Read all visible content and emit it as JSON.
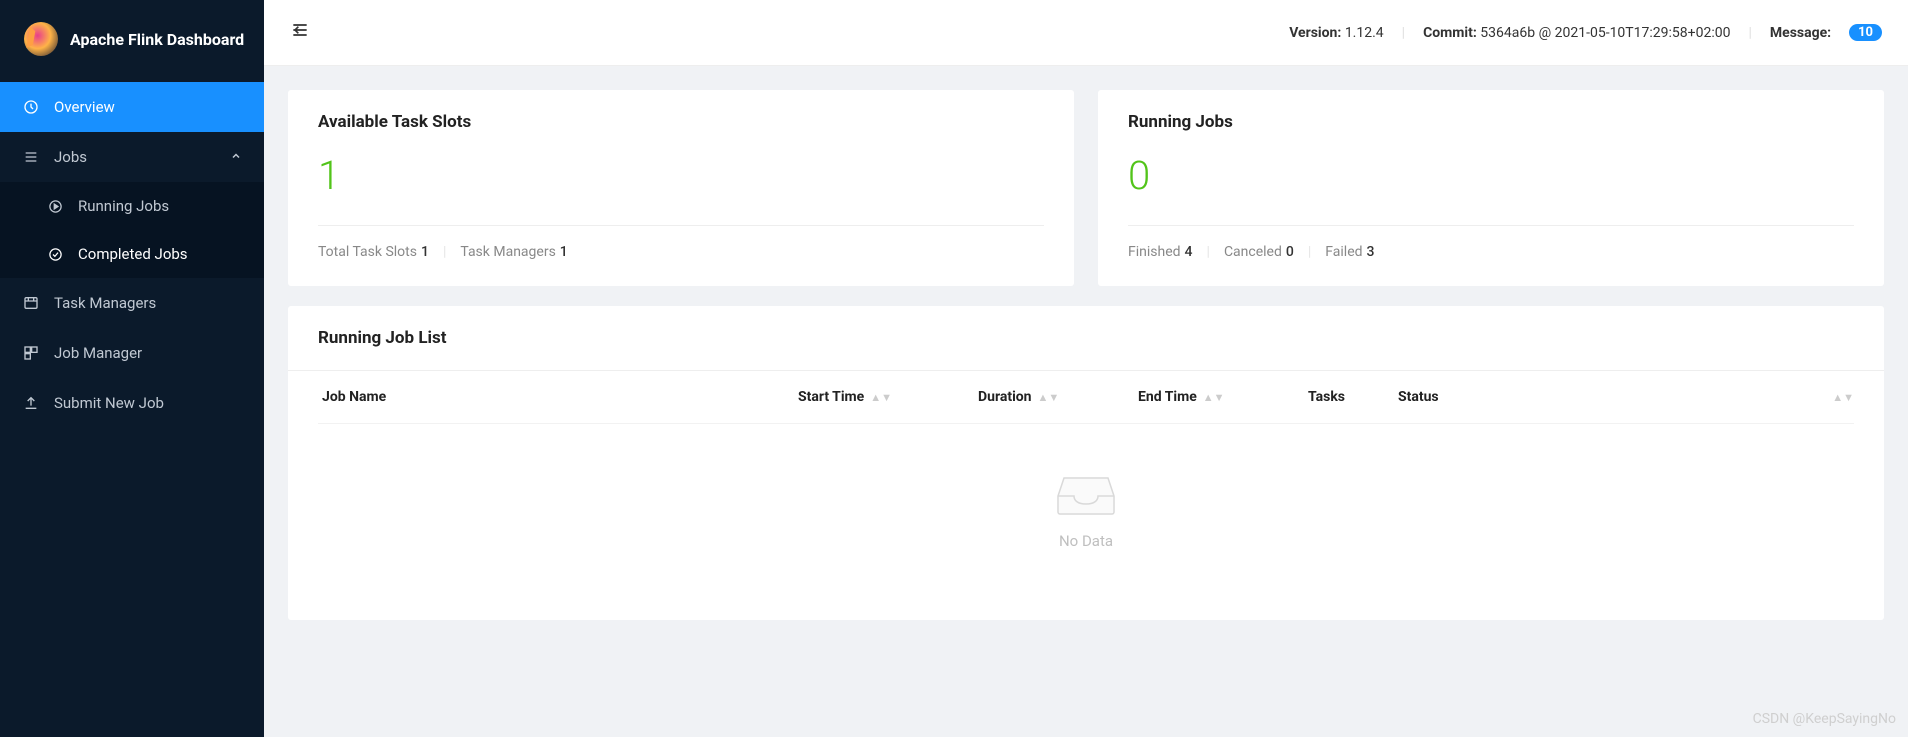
{
  "app": {
    "title": "Apache Flink Dashboard"
  },
  "sidebar": {
    "items": [
      {
        "label": "Overview"
      },
      {
        "label": "Jobs"
      },
      {
        "label": "Running Jobs"
      },
      {
        "label": "Completed Jobs"
      },
      {
        "label": "Task Managers"
      },
      {
        "label": "Job Manager"
      },
      {
        "label": "Submit New Job"
      }
    ]
  },
  "header": {
    "version_label": "Version:",
    "version_value": "1.12.4",
    "commit_label": "Commit:",
    "commit_value": "5364a6b @ 2021-05-10T17:29:58+02:00",
    "message_label": "Message:",
    "message_count": "10"
  },
  "stats": {
    "slots": {
      "title": "Available Task Slots",
      "value": "1",
      "total_label": "Total Task Slots",
      "total_value": "1",
      "tm_label": "Task Managers",
      "tm_value": "1"
    },
    "jobs": {
      "title": "Running Jobs",
      "value": "0",
      "finished_label": "Finished",
      "finished_value": "4",
      "canceled_label": "Canceled",
      "canceled_value": "0",
      "failed_label": "Failed",
      "failed_value": "3"
    }
  },
  "joblist": {
    "title": "Running Job List",
    "columns": {
      "name": "Job Name",
      "start": "Start Time",
      "duration": "Duration",
      "end": "End Time",
      "tasks": "Tasks",
      "status": "Status"
    },
    "empty": "No Data"
  },
  "watermark": "CSDN @KeepSayingNo"
}
